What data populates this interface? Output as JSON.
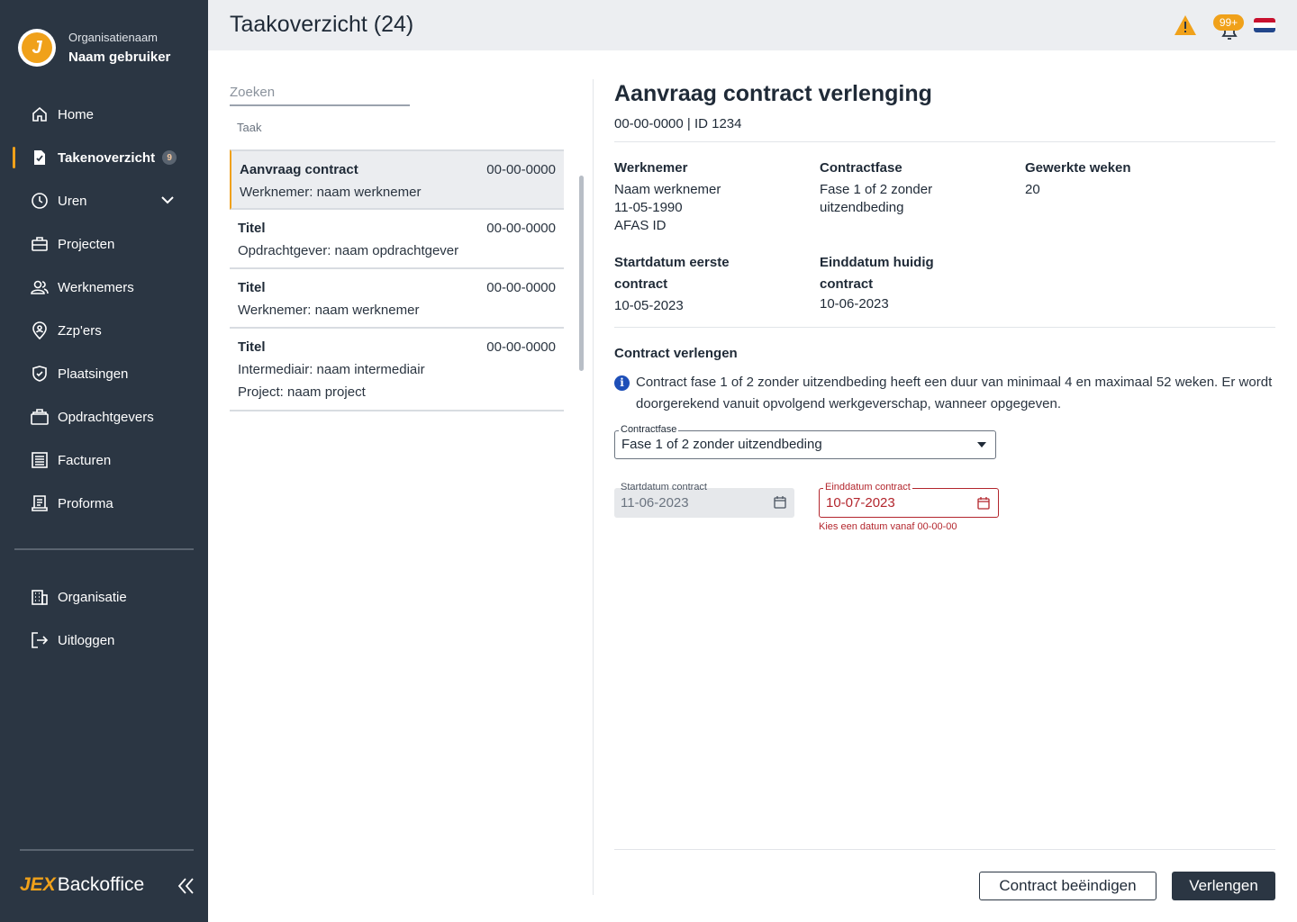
{
  "sidebar": {
    "org_name": "Organisatienaam",
    "user_name": "Naam gebruiker",
    "logo_letter": "J",
    "items": [
      {
        "label": "Home",
        "icon": "home-icon"
      },
      {
        "label": "Takenoverzicht",
        "icon": "task-icon",
        "badge": "9",
        "active": true
      },
      {
        "label": "Uren",
        "icon": "clock-icon",
        "expandable": true
      },
      {
        "label": "Projecten",
        "icon": "briefcase-icon"
      },
      {
        "label": "Werknemers",
        "icon": "people-icon"
      },
      {
        "label": "Zzp'ers",
        "icon": "location-person-icon"
      },
      {
        "label": "Plaatsingen",
        "icon": "shield-check-icon"
      },
      {
        "label": "Opdrachtgevers",
        "icon": "briefcase-stack-icon"
      },
      {
        "label": "Facturen",
        "icon": "invoice-icon"
      },
      {
        "label": "Proforma",
        "icon": "proforma-icon"
      }
    ],
    "bottom_items": [
      {
        "label": "Organisatie",
        "icon": "building-icon"
      },
      {
        "label": "Uitloggen",
        "icon": "logout-icon"
      }
    ],
    "footer_brand_prefix": "JEX",
    "footer_brand": "Backoffice"
  },
  "header": {
    "title": "Taakoverzicht (24)",
    "notification_badge": "99+",
    "accent_color": "#f0a11a"
  },
  "tasks": {
    "search_placeholder": "Zoeken",
    "column_header": "Taak",
    "items": [
      {
        "title": "Aanvraag contract",
        "date": "00-00-0000",
        "lines": [
          "Werknemer: naam werknemer"
        ],
        "active": true
      },
      {
        "title": "Titel",
        "date": "00-00-0000",
        "lines": [
          "Opdrachtgever: naam opdrachtgever"
        ]
      },
      {
        "title": "Titel",
        "date": "00-00-0000",
        "lines": [
          "Werknemer: naam werknemer"
        ]
      },
      {
        "title": "Titel",
        "date": "00-00-0000",
        "lines": [
          "Intermediair: naam intermediair",
          "Project: naam project"
        ]
      }
    ]
  },
  "detail": {
    "title": "Aanvraag contract verlenging",
    "subtitle": "00-00-0000 | ID 1234",
    "werknemer_label": "Werknemer",
    "werknemer_name": "Naam werknemer",
    "werknemer_dob": "11-05-1990",
    "werknemer_id": "AFAS ID",
    "contractfase_label": "Contractfase",
    "contractfase_value": "Fase 1 of 2 zonder uitzendbeding",
    "weken_label": "Gewerkte weken",
    "weken_value": "20",
    "start_label": "Startdatum eerste contract",
    "start_value": "10-05-2023",
    "eind_label": "Einddatum huidig contract",
    "eind_value": "10-06-2023",
    "section_title": "Contract verlengen",
    "info_text": "Contract fase 1 of 2 zonder uitzendbeding heeft een duur van minimaal 4 en maximaal 52 weken. Er wordt doorgerekend vanuit opvolgend werkgeverschap, wanneer opgegeven.",
    "select_label": "Contractfase",
    "select_value": "Fase 1 of 2 zonder uitzendbeding",
    "start_contract_label": "Startdatum contract",
    "start_contract_value": "11-06-2023",
    "end_contract_label": "Einddatum contract",
    "end_contract_value": "10-07-2023",
    "error_text": "Kies een datum vanaf 00-00-00",
    "error_color": "#b3262d",
    "btn_end": "Contract beëindigen",
    "btn_extend": "Verlengen"
  }
}
